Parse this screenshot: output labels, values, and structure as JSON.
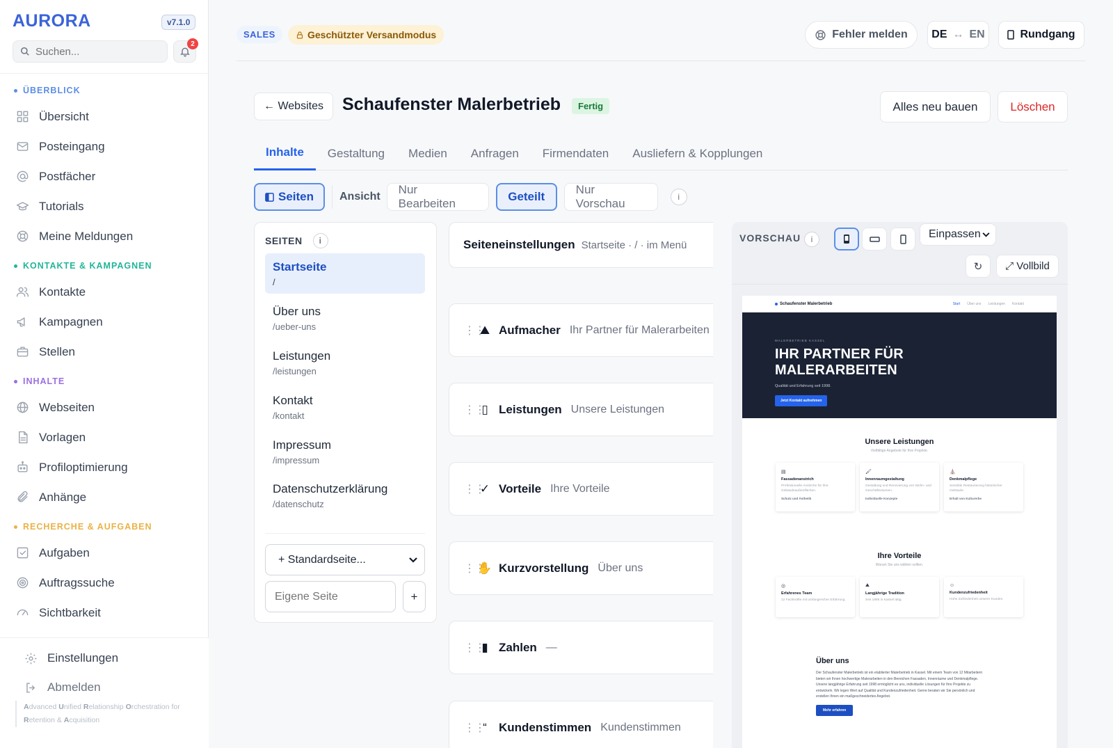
{
  "app": {
    "logo": "AURORA",
    "version": "v7.1.0",
    "notification_count": "2"
  },
  "search": {
    "placeholder": "Suchen..."
  },
  "sidebar": {
    "sections": [
      {
        "title": "ÜBERBLICK",
        "color": "#5b8ee6",
        "items": [
          {
            "label": "Übersicht",
            "icon": "grid-icon"
          },
          {
            "label": "Posteingang",
            "icon": "mail-icon"
          },
          {
            "label": "Postfächer",
            "icon": "at-icon"
          },
          {
            "label": "Tutorials",
            "icon": "graduation-icon"
          },
          {
            "label": "Meine Meldungen",
            "icon": "lifebuoy-icon"
          }
        ]
      },
      {
        "title": "KONTAKTE & KAMPAGNEN",
        "color": "#22b59a",
        "items": [
          {
            "label": "Kontakte",
            "icon": "users-icon"
          },
          {
            "label": "Kampagnen",
            "icon": "megaphone-icon"
          },
          {
            "label": "Stellen",
            "icon": "briefcase-icon"
          }
        ]
      },
      {
        "title": "INHALTE",
        "color": "#9b6fe0",
        "items": [
          {
            "label": "Webseiten",
            "icon": "globe-icon"
          },
          {
            "label": "Vorlagen",
            "icon": "document-icon"
          },
          {
            "label": "Profiloptimierung",
            "icon": "robot-icon"
          },
          {
            "label": "Anhänge",
            "icon": "paperclip-icon"
          }
        ]
      },
      {
        "title": "RECHERCHE & AUFGABEN",
        "color": "#eab245",
        "items": [
          {
            "label": "Aufgaben",
            "icon": "checkbox-icon"
          },
          {
            "label": "Auftragssuche",
            "icon": "target-icon"
          },
          {
            "label": "Sichtbarkeit",
            "icon": "gauge-icon"
          }
        ]
      }
    ],
    "bottom": {
      "settings": "Einstellungen",
      "logout": "Abmelden"
    },
    "tagline": [
      "A",
      "dvanced ",
      "U",
      "nified ",
      "R",
      "elationship ",
      "O",
      "rchestration for ",
      "R",
      "etention & ",
      "A",
      "cquisition"
    ]
  },
  "topbar": {
    "mode": "SALES",
    "protected": "Geschützter Versandmodus",
    "report": "Fehler melden",
    "lang_from": "DE",
    "lang_arrow": "↔",
    "lang_to": "EN",
    "tour": "Rundgang"
  },
  "header": {
    "back": "← Websites",
    "title": "Schaufenster Malerbetrieb",
    "status": "Fertig",
    "rebuild": "Alles neu bauen",
    "delete": "Löschen"
  },
  "tabs": [
    "Inhalte",
    "Gestaltung",
    "Medien",
    "Anfragen",
    "Firmendaten",
    "Ausliefern & Kopplungen"
  ],
  "view": {
    "pages_btn": "Seiten",
    "label": "Ansicht",
    "edit_only": "Nur Bearbeiten",
    "split": "Geteilt",
    "preview_only": "Nur Vorschau",
    "info": "i"
  },
  "pages": {
    "header": "SEITEN",
    "items": [
      {
        "name": "Startseite",
        "path": "/"
      },
      {
        "name": "Über uns",
        "path": "/ueber-uns"
      },
      {
        "name": "Leistungen",
        "path": "/leistungen"
      },
      {
        "name": "Kontakt",
        "path": "/kontakt"
      },
      {
        "name": "Impressum",
        "path": "/impressum"
      },
      {
        "name": "Datenschutzerklärung",
        "path": "/datenschutz"
      }
    ],
    "add_standard": "+ Standardseite...",
    "own_placeholder": "Eigene Seite",
    "add": "+"
  },
  "sections": {
    "settings": {
      "title": "Seiteneinstellungen",
      "meta": "Startseite · / · im Menü"
    },
    "blocks": [
      {
        "title": "Aufmacher",
        "subtitle": "Ihr Partner für Malerarbeiten",
        "icon": "mountain-icon",
        "glyph": "⛰"
      },
      {
        "title": "Leistungen",
        "subtitle": "Unsere Leistungen",
        "icon": "box-icon",
        "glyph": "▯"
      },
      {
        "title": "Vorteile",
        "subtitle": "Ihre Vorteile",
        "icon": "check-icon",
        "glyph": "✓"
      },
      {
        "title": "Kurzvorstellung",
        "subtitle": "Über uns",
        "icon": "wave-icon",
        "glyph": "✋"
      },
      {
        "title": "Zahlen",
        "subtitle": "—",
        "icon": "bar-chart-icon",
        "glyph": "▮"
      },
      {
        "title": "Kundenstimmen",
        "subtitle": "Kundenstimmen",
        "icon": "quote-icon",
        "glyph": "“"
      }
    ]
  },
  "preview": {
    "label": "VORSCHAU",
    "fit": "Einpassen",
    "refresh": "↻",
    "fullscreen": "⤢ Vollbild",
    "site": {
      "brand": "Schaufenster Malerbetrieb",
      "nav": [
        "Start",
        "Über uns",
        "Leistungen",
        "Kontakt"
      ],
      "hero_kicker": "MALERBETRIEB KASSEL",
      "hero_title": "IHR PARTNER FÜR MALERARBEITEN",
      "hero_sub": "Qualität und Erfahrung seit 1998.",
      "hero_cta": "Jetzt Kontakt aufnehmen",
      "services_title": "Unsere Leistungen",
      "services_sub": "Vielfältige Angebote für Ihre Projekte.",
      "services": [
        {
          "icon": "▤",
          "title": "Fassadenanstrich",
          "desc": "Professionelle Anstriche für Ihre Gebäudeaußenflächen.",
          "link": "Schutz und Ästhetik"
        },
        {
          "icon": "🖌",
          "title": "Innenraumgestaltung",
          "desc": "Gestaltung und Renovierung von Wohn- und Geschäftsräumen.",
          "link": "Individuelle Konzepte"
        },
        {
          "icon": "⛪",
          "title": "Denkmalpflege",
          "desc": "Sensible Restaurierung historischer Gebäude.",
          "link": "Erhalt von Kulturerbe"
        }
      ],
      "advantages_title": "Ihre Vorteile",
      "advantages_sub": "Warum Sie uns wählen sollten.",
      "advantages": [
        {
          "icon": "◎",
          "title": "Erfahrenes Team",
          "desc": "12 Fachkräfte mit umfangreicher Erfahrung."
        },
        {
          "icon": "⛰",
          "title": "Langjährige Tradition",
          "desc": "Seit 1998 in Kassel tätig."
        },
        {
          "icon": "☺",
          "title": "Kundenzufriedenheit",
          "desc": "Hohe Zufriedenheit unserer Kunden."
        }
      ],
      "about_title": "Über uns",
      "about_text": "Der Schaufenster Malerbetrieb ist ein etablierter Malerbetrieb in Kassel. Mit einem Team von 12 Mitarbeitern bieten wir Ihnen hochwertige Malerarbeiten in den Bereichen Fassaden, Innenräume und Denkmalpflege. Unsere langjährige Erfahrung seit 1998 ermöglicht es uns, individuelle Lösungen für Ihre Projekte zu entwickeln. Wir legen Wert auf Qualität und Kundenzufriedenheit. Gerne beraten wir Sie persönlich und erstellen Ihnen ein maßgeschneidertes Angebot.",
      "about_btn": "Mehr erfahren"
    }
  }
}
